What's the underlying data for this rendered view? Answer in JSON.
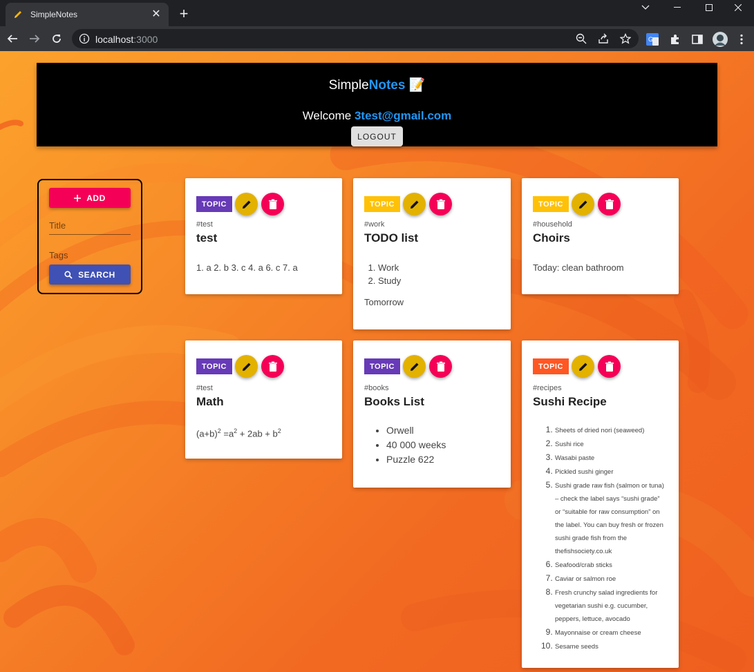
{
  "browser": {
    "tab_title": "SimpleNotes",
    "url_host": "localhost",
    "url_port": ":3000",
    "colors": {
      "tabbar": "#202124",
      "toolbar": "#35363a"
    }
  },
  "header": {
    "title_part1": "Simple",
    "title_part2": "Notes",
    "title_emoji": "📝",
    "welcome_text": "Welcome ",
    "email": "3test@gmail.com",
    "logout_label": "LOGOUT"
  },
  "sidebar": {
    "add_label": "ADD",
    "title_placeholder": "Title",
    "tags_placeholder": "Tags",
    "search_label": "SEARCH"
  },
  "notes": [
    {
      "chip": "TOPIC",
      "chip_color": "#673ab7",
      "tag": "#test",
      "title": "test",
      "content": "1. a 2. b 3. c 4. a 6. c 7. a"
    },
    {
      "chip": "TOPIC",
      "chip_color": "#ffc107",
      "tag": "#work",
      "title": "TODO list",
      "items": [
        "Work",
        "Study"
      ],
      "after": "Tomorrow"
    },
    {
      "chip": "TOPIC",
      "chip_color": "#ffc107",
      "tag": "#household",
      "title": "Choirs",
      "content": "Today: clean bathroom"
    },
    {
      "chip": "TOPIC",
      "chip_color": "#673ab7",
      "tag": "#test",
      "title": "Math",
      "math": {
        "a": "(a+b)",
        "p1": "2",
        "mid": " =a",
        "p2": "2",
        "mid2": " + 2ab + b",
        "p3": "2"
      }
    },
    {
      "chip": "TOPIC",
      "chip_color": "#673ab7",
      "tag": "#books",
      "title": "Books List",
      "items": [
        "Orwell",
        "40 000 weeks",
        "Puzzle 622"
      ]
    },
    {
      "chip": "TOPIC",
      "chip_color": "#ff5722",
      "tag": "#recipes",
      "title": "Sushi Recipe",
      "items": [
        "Sheets of dried nori (seaweed)",
        "Sushi rice",
        "Wasabi paste",
        "Pickled sushi ginger",
        "Sushi grade raw fish (salmon or tuna) – check the label says “sushi grade” or “suitable for raw consumption” on the label. You can buy fresh or frozen sushi grade fish from the thefishsociety.co.uk",
        "Seafood/crab sticks",
        "Caviar or salmon roe",
        "Fresh crunchy salad ingredients for vegetarian sushi e.g. cucumber, peppers, lettuce, avocado",
        "Mayonnaise or cream cheese",
        "Sesame seeds"
      ]
    }
  ]
}
